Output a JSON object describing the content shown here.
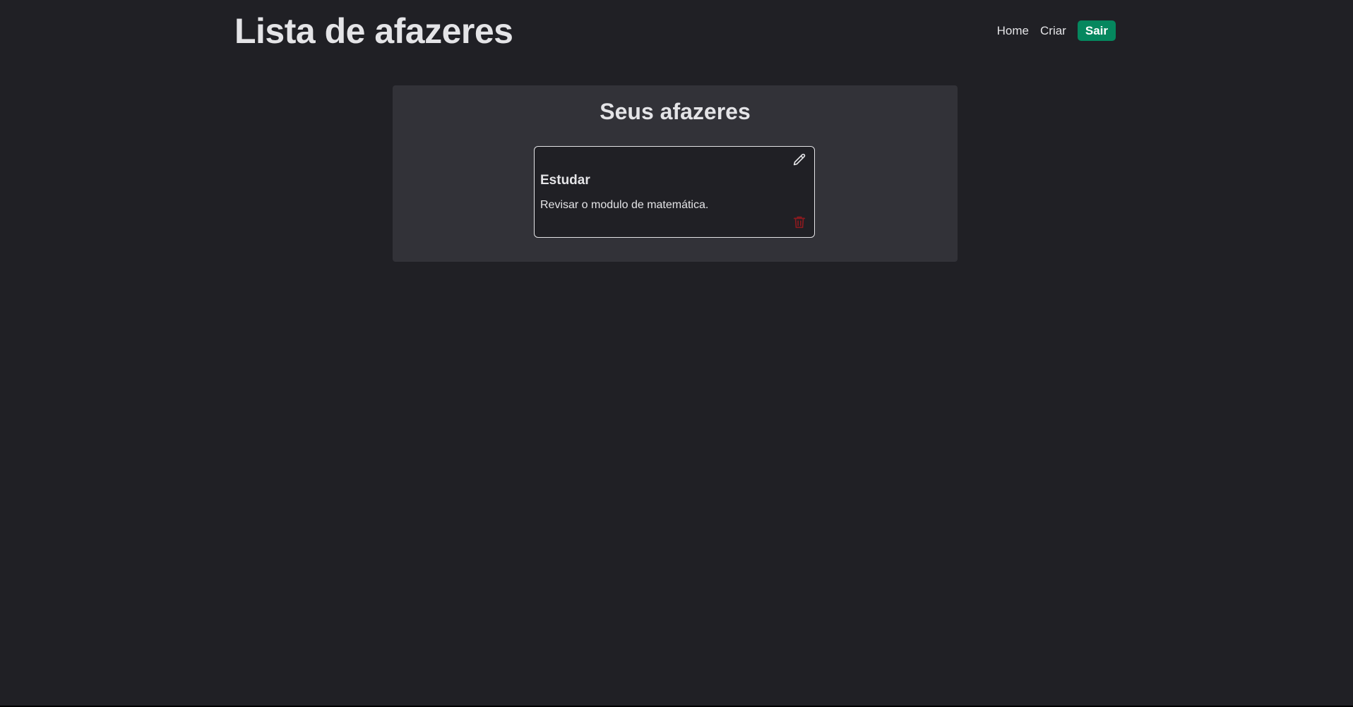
{
  "header": {
    "title": "Lista de afazeres",
    "nav": {
      "home_label": "Home",
      "create_label": "Criar",
      "logout_label": "Sair"
    }
  },
  "main": {
    "title": "Seus afazeres",
    "todos": [
      {
        "title": "Estudar",
        "description": "Revisar o modulo de matemática.",
        "edit_icon": "pencil-icon",
        "delete_icon": "trash-icon"
      }
    ]
  },
  "colors": {
    "background": "#202025",
    "panel": "#323238",
    "accent": "#05875e",
    "danger": "#8b1a1f",
    "text": "#e4e4e7"
  }
}
